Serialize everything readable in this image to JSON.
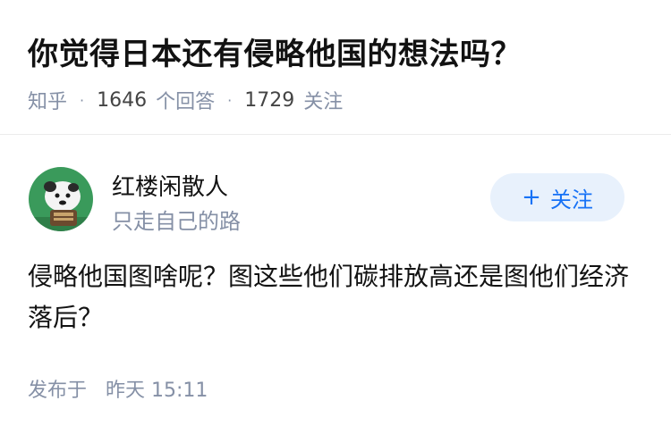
{
  "question": {
    "title": "你觉得日本还有侵略他国的想法吗？",
    "source": "知乎",
    "answer_count": "1646",
    "answer_label": "个回答",
    "follower_count": "1729",
    "follower_label": "关注",
    "separator": "·"
  },
  "answer": {
    "author": {
      "name": "红楼闲散人",
      "bio": "只走自己的路",
      "avatar_icon": "avatar-illustration"
    },
    "follow_button": {
      "icon": "plus",
      "label": "关注"
    },
    "content": "侵略他国图啥呢？图这些他们碳排放高还是图他们经济落后？",
    "publish_label": "发布于",
    "publish_time": "昨天 15:11"
  },
  "colors": {
    "accent": "#1772f6",
    "accent_bg": "#e8f1fc",
    "meta_text": "#8590a6",
    "avatar_bg": "#3a9a5b"
  }
}
